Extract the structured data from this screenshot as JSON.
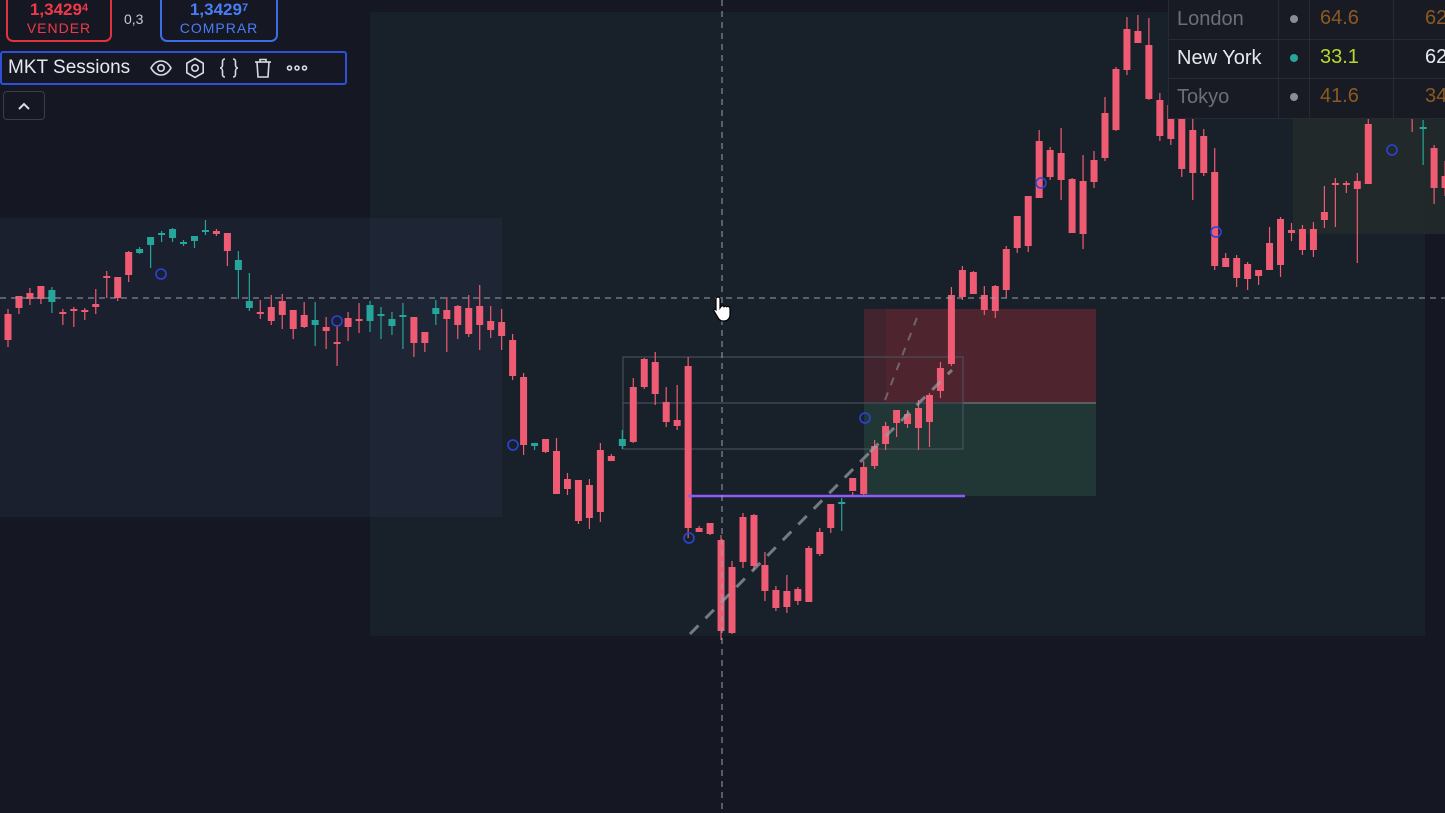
{
  "trade": {
    "sell_price": "1,3429",
    "sell_price_sup": "4",
    "sell_label": "VENDER",
    "spread": "0,3",
    "buy_price": "1,3429",
    "buy_price_sup": "7",
    "buy_label": "COMPRAR"
  },
  "indicator": {
    "title": "MKT Sessions",
    "icons": [
      "eye-icon",
      "settings-icon",
      "source-code-icon",
      "trash-icon",
      "more-icon"
    ]
  },
  "sessions": [
    {
      "name": "London",
      "value": "64.6",
      "value2": "62",
      "active": false
    },
    {
      "name": "New York",
      "value": "33.1",
      "value2": "62",
      "active": true
    },
    {
      "name": "Tokyo",
      "value": "41.6",
      "value2": "34",
      "active": false
    }
  ],
  "colors": {
    "bull": "#26a69a",
    "bear": "#ef5b72",
    "sell": "#e0323f",
    "buy": "#3d6ee8",
    "session_active": "#26a69a",
    "session_inactive": "#8a8d96"
  },
  "chart_data": {
    "type": "candlestick",
    "title": "",
    "crosshair": {
      "vertical": true,
      "horizontal": true
    },
    "candles": [
      [
        309,
        314,
        340,
        347
      ],
      [
        298,
        296,
        308,
        314
      ],
      [
        288,
        293,
        299,
        305
      ],
      [
        291,
        286,
        299,
        304
      ],
      [
        287,
        302,
        290,
        313
      ],
      [
        309,
        312,
        314,
        325
      ],
      [
        307,
        309,
        310,
        327
      ],
      [
        308,
        310,
        312,
        320
      ],
      [
        289,
        304,
        307,
        314
      ],
      [
        271,
        276,
        277,
        298
      ],
      [
        279,
        277,
        298,
        301
      ],
      [
        251,
        252,
        275,
        282
      ],
      [
        247,
        253,
        249,
        254
      ],
      [
        237,
        245,
        237,
        268
      ],
      [
        231,
        235,
        233,
        242
      ],
      [
        228,
        238,
        229,
        242
      ],
      [
        240,
        243,
        242,
        246
      ],
      [
        236,
        241,
        236,
        248
      ],
      [
        220,
        232,
        230,
        235
      ],
      [
        229,
        231,
        234,
        236
      ],
      [
        241,
        233,
        251,
        266
      ],
      [
        251,
        270,
        260,
        299
      ],
      [
        273,
        308,
        301,
        311
      ],
      [
        300,
        312,
        313,
        319
      ],
      [
        295,
        307,
        321,
        325
      ],
      [
        294,
        301,
        315,
        329
      ],
      [
        313,
        310,
        329,
        339
      ],
      [
        302,
        315,
        327,
        328
      ],
      [
        302,
        325,
        320,
        346
      ],
      [
        317,
        327,
        331,
        349
      ],
      [
        325,
        342,
        344,
        366
      ],
      [
        312,
        318,
        327,
        341
      ],
      [
        303,
        319,
        320,
        333
      ],
      [
        301,
        321,
        305,
        332
      ],
      [
        307,
        316,
        314,
        339
      ],
      [
        312,
        326,
        319,
        335
      ],
      [
        303,
        317,
        315,
        349
      ],
      [
        318,
        317,
        343,
        357
      ],
      [
        343,
        332,
        343,
        352
      ],
      [
        300,
        314,
        308,
        325
      ],
      [
        297,
        310,
        319,
        352
      ],
      [
        305,
        306,
        325,
        339
      ],
      [
        295,
        308,
        334,
        337
      ],
      [
        285,
        306,
        325,
        350
      ],
      [
        306,
        321,
        330,
        338
      ],
      [
        309,
        322,
        336,
        350
      ],
      [
        334,
        340,
        376,
        380
      ],
      [
        373,
        377,
        445,
        455
      ],
      [
        446,
        446,
        443,
        450
      ],
      [
        446,
        439,
        452,
        453
      ],
      [
        438,
        451,
        494,
        492
      ],
      [
        473,
        479,
        489,
        495
      ],
      [
        492,
        480,
        521,
        524
      ],
      [
        479,
        485,
        518,
        529
      ],
      [
        443,
        450,
        512,
        522
      ],
      [
        454,
        456,
        461,
        460
      ],
      [
        430,
        446,
        439,
        449
      ],
      [
        378,
        387,
        442,
        443
      ],
      [
        358,
        359,
        387,
        389
      ],
      [
        352,
        362,
        394,
        405
      ],
      [
        387,
        402,
        422,
        427
      ],
      [
        385,
        420,
        426,
        430
      ],
      [
        357,
        366,
        528,
        538
      ],
      [
        526,
        528,
        532,
        532
      ],
      [
        530,
        523,
        534,
        535
      ],
      [
        535,
        540,
        631,
        640
      ],
      [
        561,
        567,
        633,
        634
      ],
      [
        513,
        517,
        562,
        568
      ],
      [
        514,
        515,
        566,
        570
      ],
      [
        552,
        565,
        591,
        601
      ],
      [
        586,
        590,
        608,
        611
      ],
      [
        575,
        591,
        607,
        613
      ],
      [
        587,
        589,
        601,
        605
      ],
      [
        546,
        548,
        602,
        601
      ],
      [
        528,
        532,
        554,
        556
      ],
      [
        511,
        504,
        528,
        533
      ],
      [
        498,
        504,
        502,
        531
      ],
      [
        492,
        478,
        491,
        497
      ],
      [
        461,
        467,
        494,
        496
      ],
      [
        440,
        446,
        466,
        469
      ],
      [
        422,
        426,
        444,
        450
      ],
      [
        413,
        410,
        423,
        437
      ],
      [
        410,
        414,
        424,
        428
      ],
      [
        400,
        408,
        428,
        450
      ],
      [
        393,
        395,
        422,
        447
      ],
      [
        362,
        368,
        391,
        398
      ],
      [
        287,
        295,
        364,
        366
      ],
      [
        266,
        270,
        297,
        300
      ],
      [
        271,
        272,
        294,
        294
      ],
      [
        286,
        295,
        310,
        315
      ],
      [
        285,
        286,
        311,
        318
      ],
      [
        246,
        249,
        290,
        298
      ],
      [
        216,
        216,
        248,
        253
      ],
      [
        196,
        196,
        246,
        252
      ],
      [
        130,
        141,
        198,
        195
      ],
      [
        147,
        150,
        177,
        180
      ],
      [
        128,
        153,
        180,
        200
      ],
      [
        178,
        179,
        233,
        232
      ],
      [
        155,
        181,
        234,
        249
      ],
      [
        151,
        160,
        182,
        188
      ],
      [
        97,
        113,
        158,
        161
      ],
      [
        67,
        69,
        130,
        131
      ],
      [
        17,
        29,
        70,
        75
      ],
      [
        15,
        31,
        43,
        43
      ],
      [
        18,
        45,
        99,
        100
      ],
      [
        93,
        100,
        136,
        141
      ],
      [
        103,
        105,
        139,
        145
      ],
      [
        128,
        105,
        169,
        177
      ],
      [
        118,
        130,
        173,
        200
      ],
      [
        129,
        136,
        173,
        176
      ],
      [
        148,
        172,
        266,
        270
      ],
      [
        253,
        258,
        267,
        266
      ],
      [
        255,
        258,
        278,
        287
      ],
      [
        262,
        264,
        279,
        290
      ],
      [
        272,
        270,
        276,
        285
      ],
      [
        227,
        243,
        270,
        270
      ],
      [
        217,
        219,
        265,
        277
      ],
      [
        223,
        230,
        233,
        241
      ],
      [
        225,
        229,
        250,
        255
      ],
      [
        222,
        229,
        250,
        257
      ],
      [
        186,
        212,
        220,
        228
      ],
      [
        178,
        183,
        185,
        227
      ],
      [
        181,
        183,
        184,
        193
      ],
      [
        173,
        181,
        189,
        263
      ],
      [
        110,
        124,
        184,
        182
      ],
      [
        59,
        75,
        111,
        112
      ],
      [
        54,
        59,
        75,
        88
      ],
      [
        76,
        86,
        84,
        115
      ],
      [
        93,
        109,
        116,
        132
      ],
      [
        120,
        129,
        127,
        165
      ],
      [
        145,
        148,
        188,
        204
      ],
      [
        161,
        176,
        188,
        196
      ],
      [
        100,
        116,
        142,
        162
      ],
      [
        142,
        152,
        179,
        189
      ],
      [
        124,
        137,
        174,
        191
      ],
      [
        121,
        138,
        163,
        196
      ],
      [
        150,
        165,
        209,
        210
      ],
      [
        102,
        113,
        181,
        175
      ]
    ],
    "markers": [
      {
        "type": "open-circle",
        "color": "#2b44d6",
        "count": 12
      },
      {
        "type": "trend-line",
        "color": "#8b5cf6"
      }
    ],
    "sessions_shaded": [
      "previous-session",
      "current-session",
      "risk-reward-box"
    ]
  }
}
